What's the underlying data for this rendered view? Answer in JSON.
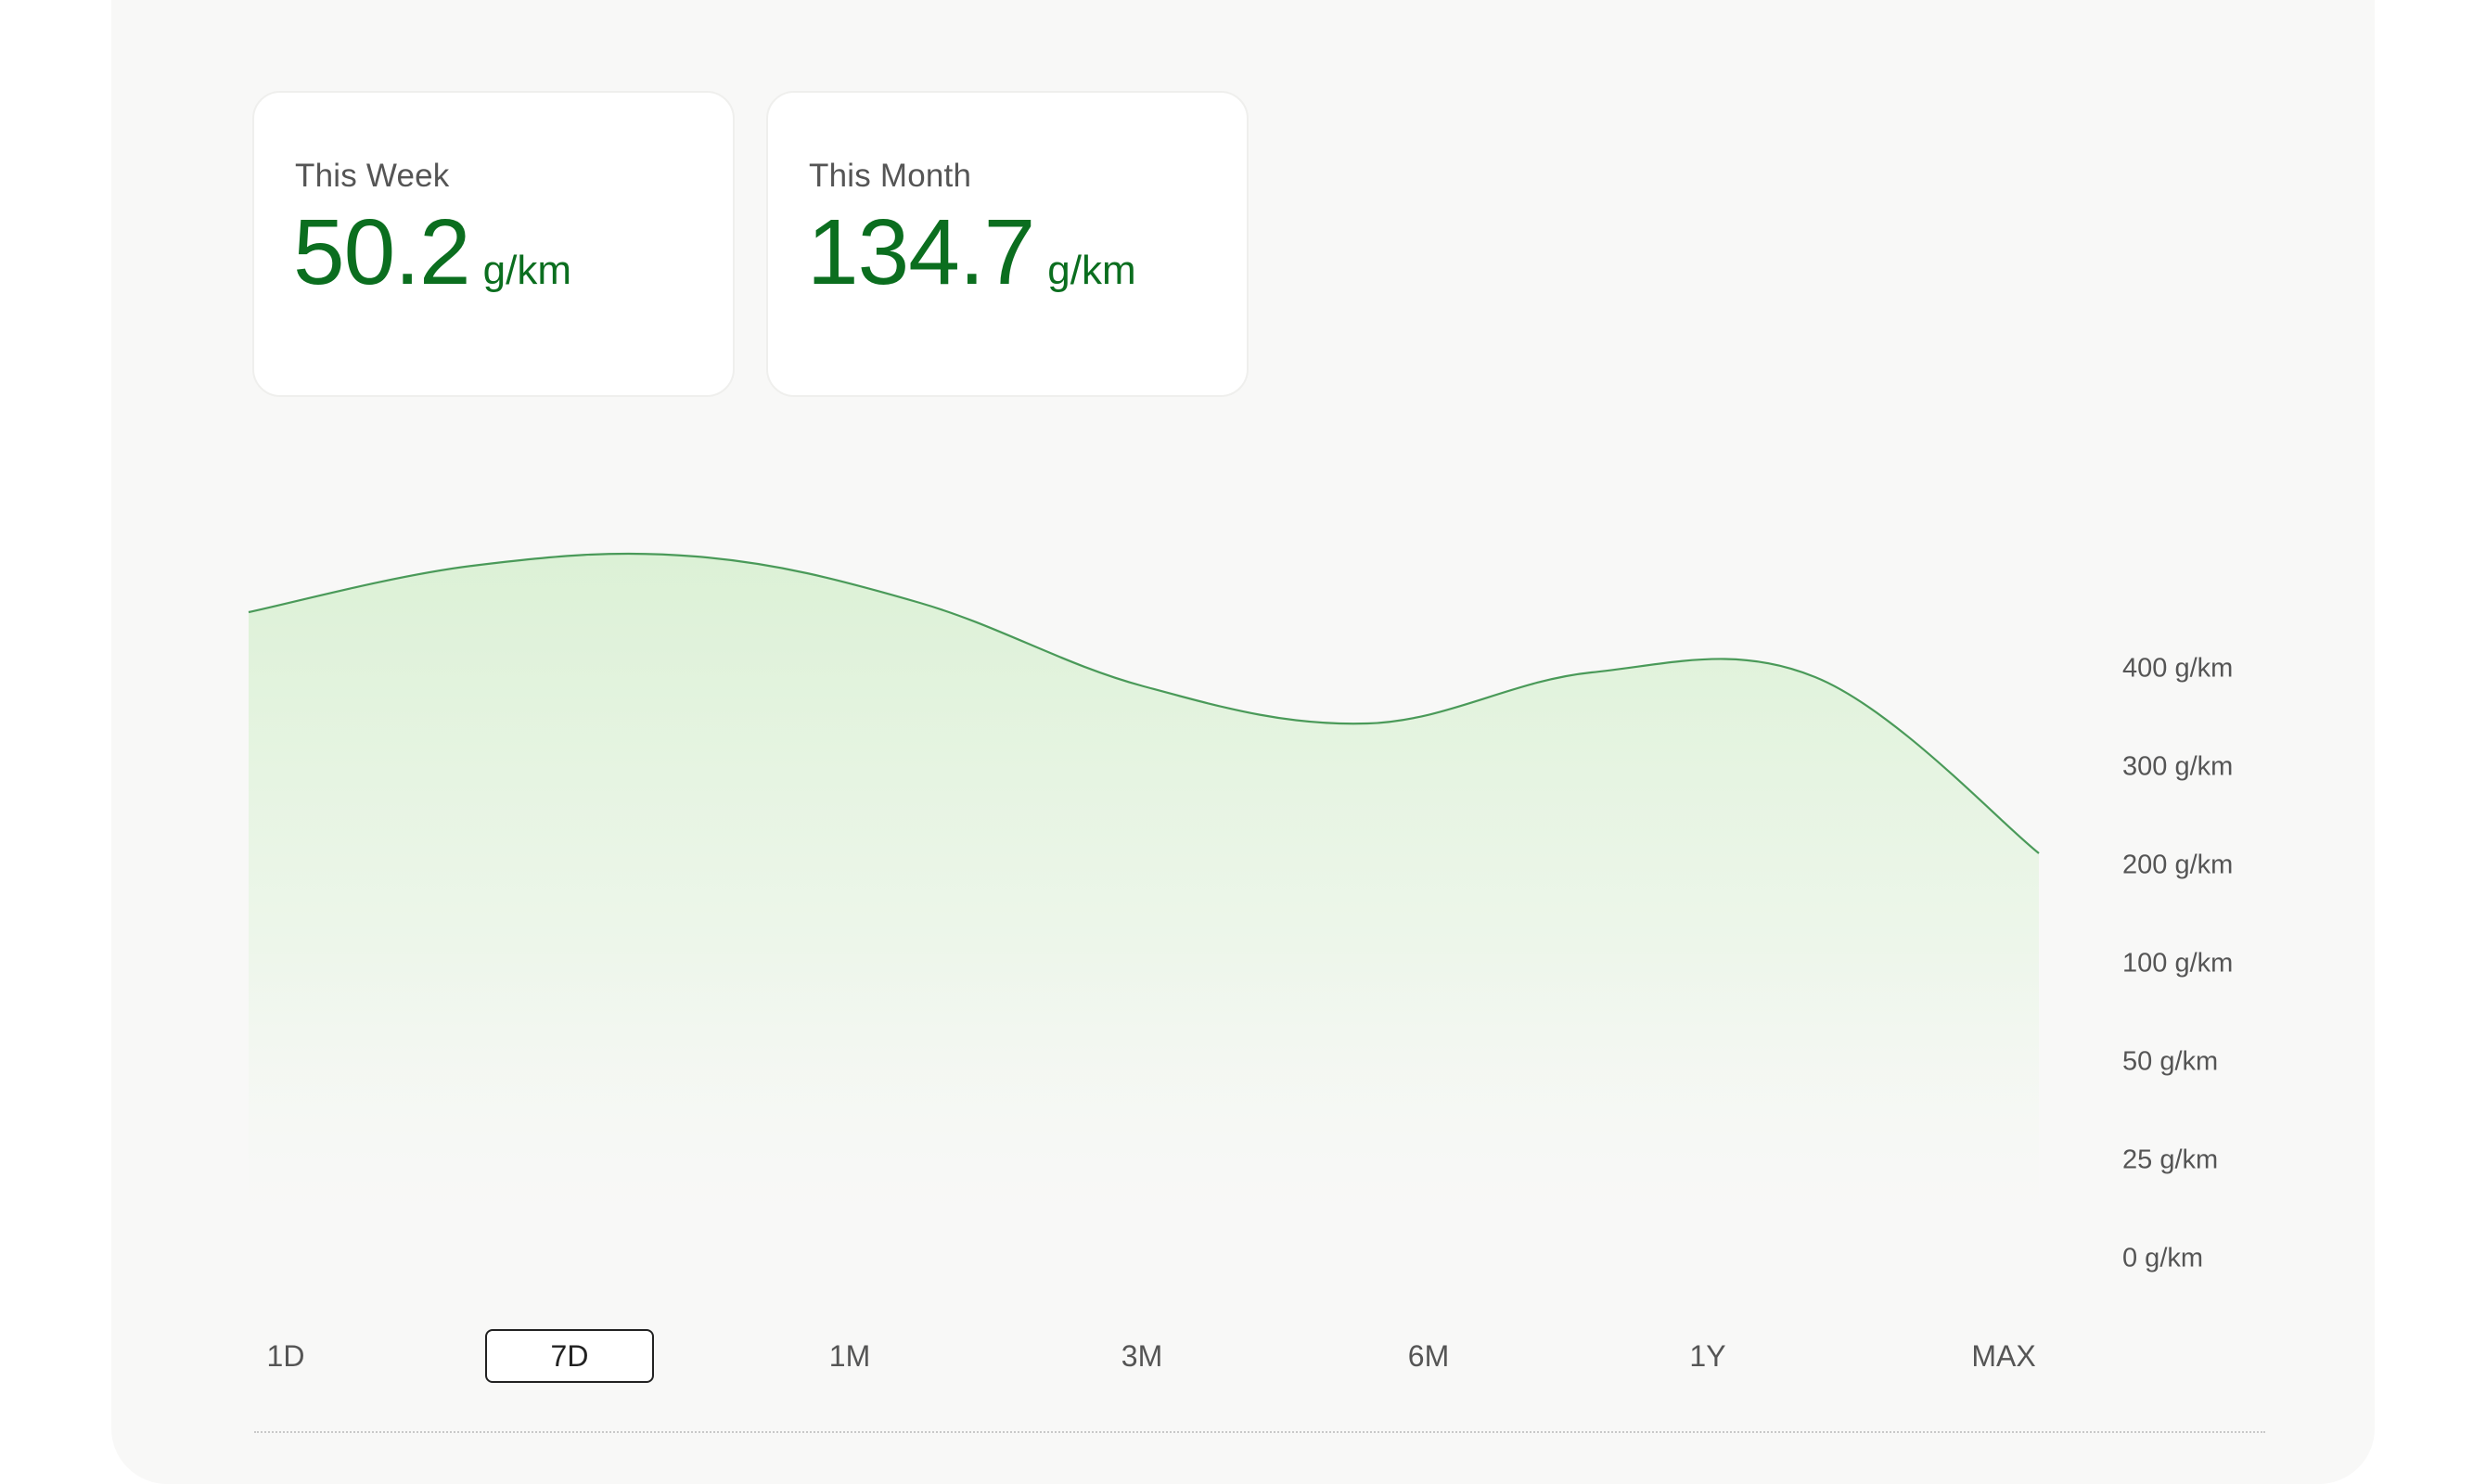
{
  "stats": {
    "week": {
      "label": "This Week",
      "value": "50.2",
      "unit": "g/km"
    },
    "month": {
      "label": "This Month",
      "value": "134.7",
      "unit": "g/km"
    }
  },
  "colors": {
    "accent": "#0b6e1f",
    "line": "#4a9a59",
    "fill_top": "#dff2da",
    "panel": "#f8f8f7"
  },
  "y_axis": {
    "labels": [
      "400 g/km",
      "300 g/km",
      "200 g/km",
      "100 g/km",
      "50 g/km",
      "25 g/km",
      "0 g/km"
    ]
  },
  "range_selector": {
    "options": [
      "1D",
      "7D",
      "1M",
      "3M",
      "6M",
      "1Y",
      "MAX"
    ],
    "selected": "7D"
  },
  "chart_data": {
    "type": "area",
    "y_ticks": [
      "400 g/km",
      "300 g/km",
      "200 g/km",
      "100 g/km",
      "50 g/km",
      "25 g/km",
      "0 g/km"
    ],
    "y_tick_values": [
      400,
      300,
      200,
      100,
      50,
      25,
      0
    ],
    "scale": "non-linear (categorical tick spacing)",
    "grid": false,
    "series": [
      {
        "values": [
          640,
          690,
          700,
          650,
          560,
          520,
          575,
          570,
          380
        ]
      }
    ]
  }
}
